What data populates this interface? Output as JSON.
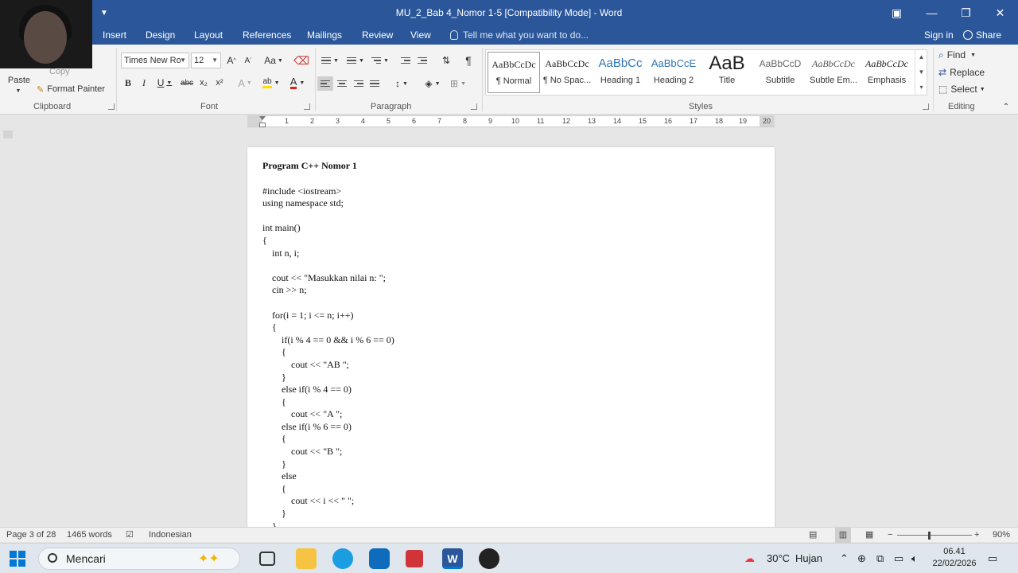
{
  "titlebar": {
    "title": "MU_2_Bab 4_Nomor 1-5 [Compatibility Mode] - Word",
    "qat_icon": "customize-qat-icon"
  },
  "tabs": [
    "Insert",
    "Design",
    "Layout",
    "References",
    "Mailings",
    "Review",
    "View"
  ],
  "tellme": "Tell me what you want to do...",
  "signin": "Sign in",
  "share": "Share",
  "clipboard": {
    "copy": "Copy",
    "paste": "Paste",
    "format_painter": "Format Painter",
    "label": "Clipboard"
  },
  "font": {
    "name": "Times New Ro",
    "size": "12",
    "label": "Font",
    "bold": "B",
    "italic": "I",
    "underline": "U",
    "strike": "abc",
    "sub": "x₂",
    "sup": "x²",
    "grow": "A",
    "shrink": "A",
    "case": "Aa",
    "effects": "A",
    "highlight": "ab",
    "color": "A"
  },
  "paragraph": {
    "label": "Paragraph",
    "pilcrow": "¶"
  },
  "styles": {
    "label": "Styles",
    "items": [
      {
        "preview": "AaBbCcDc",
        "name": "¶ Normal"
      },
      {
        "preview": "AaBbCcDc",
        "name": "¶ No Spac..."
      },
      {
        "preview": "AaBbCc",
        "name": "Heading 1"
      },
      {
        "preview": "AaBbCcE",
        "name": "Heading 2"
      },
      {
        "preview": "AaB",
        "name": "Title"
      },
      {
        "preview": "AaBbCcD",
        "name": "Subtitle"
      },
      {
        "preview": "AaBbCcDc",
        "name": "Subtle Em..."
      },
      {
        "preview": "AaBbCcDc",
        "name": "Emphasis"
      }
    ]
  },
  "editing": {
    "label": "Editing",
    "find": "Find",
    "replace": "Replace",
    "select": "Select"
  },
  "ruler": [
    "1",
    "2",
    "3",
    "4",
    "5",
    "6",
    "7",
    "8",
    "9",
    "10",
    "11",
    "12",
    "13",
    "14",
    "15",
    "16",
    "17",
    "18",
    "19",
    "20"
  ],
  "document": {
    "heading": "Program C++ Nomor 1",
    "lines": [
      "",
      "#include <iostream>",
      "using namespace std;",
      "",
      "int main()",
      "{",
      "    int n, i;",
      "",
      "    cout << \"Masukkan nilai n: \";",
      "    cin >> n;",
      "",
      "    for(i = 1; i <= n; i++)",
      "    {",
      "        if(i % 4 == 0 && i % 6 == 0)",
      "        {",
      "            cout << \"AB \";",
      "        }",
      "        else if(i % 4 == 0)",
      "        {",
      "            cout << \"A \";",
      "        else if(i % 6 == 0)",
      "        {",
      "            cout << \"B \";",
      "        }",
      "        else",
      "        {",
      "            cout << i << \" \";",
      "        }",
      "    }"
    ]
  },
  "status": {
    "page": "Page 3 of 28",
    "words": "1465 words",
    "language": "Indonesian",
    "zoom": "90%"
  },
  "taskbar": {
    "search": "Mencari",
    "weather_temp": "30°C",
    "weather_desc": "Hujan",
    "time": "06.41",
    "date": "22/02/2026"
  }
}
